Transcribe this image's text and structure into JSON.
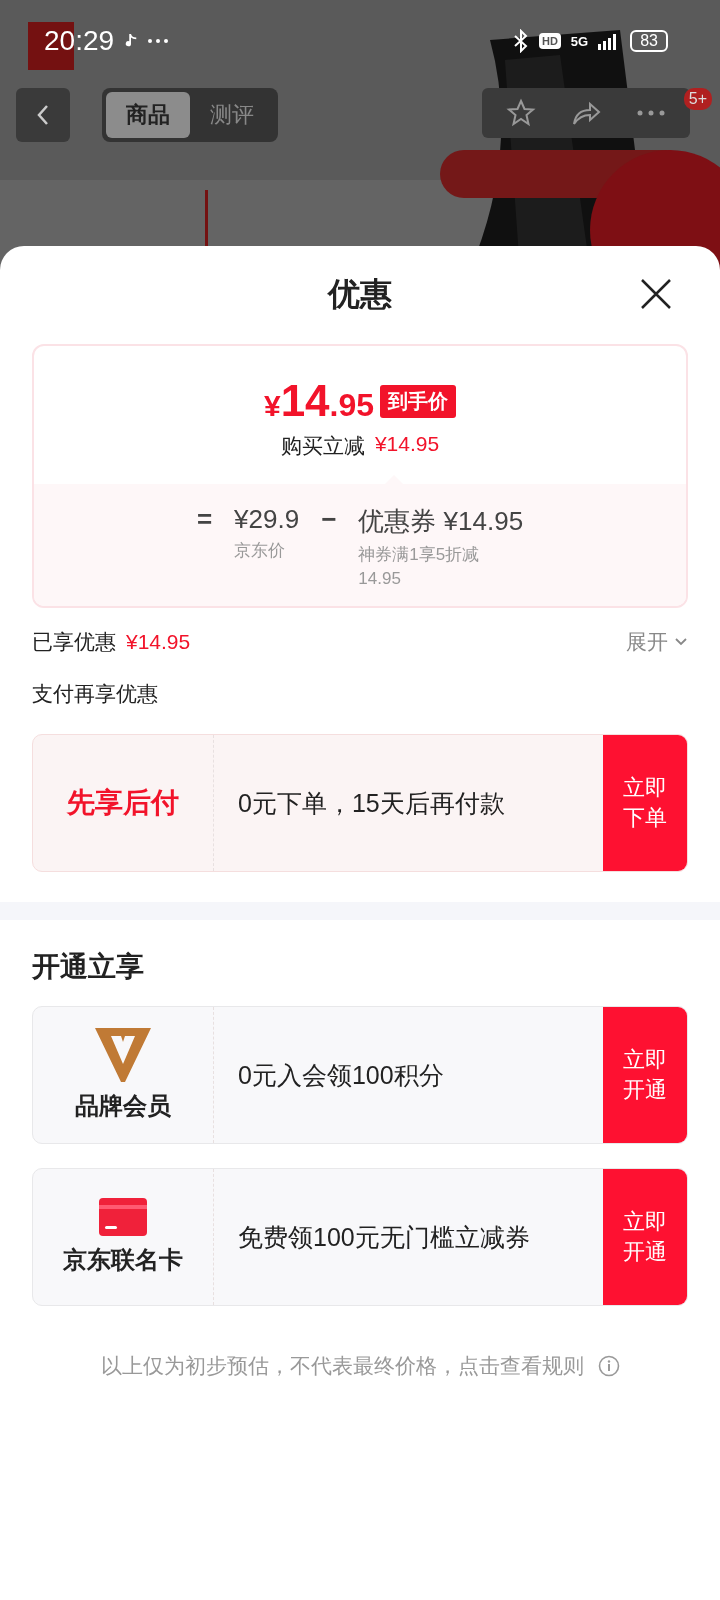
{
  "status_bar": {
    "time": "20:29",
    "hd": "HD",
    "network": "5G",
    "battery": "83"
  },
  "nav": {
    "tabs": [
      {
        "label": "商品",
        "selected": true
      },
      {
        "label": "测评",
        "selected": false
      }
    ],
    "badge": "5+"
  },
  "sheet": {
    "title": "优惠"
  },
  "price_card": {
    "currency": "¥",
    "integer": "14",
    "decimal": ".95",
    "tag": "到手价",
    "reduce_label": "购买立减",
    "reduce_amount": "¥14.95",
    "breakdown": {
      "equals": "=",
      "jd_price": "¥29.9",
      "jd_label": "京东价",
      "minus": "−",
      "coupon": "优惠券 ¥14.95",
      "coupon_desc": "神券满1享5折减14.95"
    }
  },
  "savings": {
    "label": "已享优惠",
    "amount": "¥14.95",
    "expand": "展开",
    "expanded": false
  },
  "pay_section": {
    "title": "支付再享优惠",
    "offers": [
      {
        "kind": "text",
        "name": "先享后付",
        "desc": "0元下单，15天后再付款",
        "action": "立即下单"
      }
    ]
  },
  "open_section": {
    "title": "开通立享",
    "offers": [
      {
        "kind": "member",
        "name": "品牌会员",
        "desc": "0元入会领100积分",
        "action": "立即开通"
      },
      {
        "kind": "card",
        "name": "京东联名卡",
        "desc": "免费领100元无门槛立减券",
        "action": "立即开通"
      }
    ]
  },
  "footer": {
    "note": "以上仅为初步预估，不代表最终价格，点击查看规则"
  }
}
